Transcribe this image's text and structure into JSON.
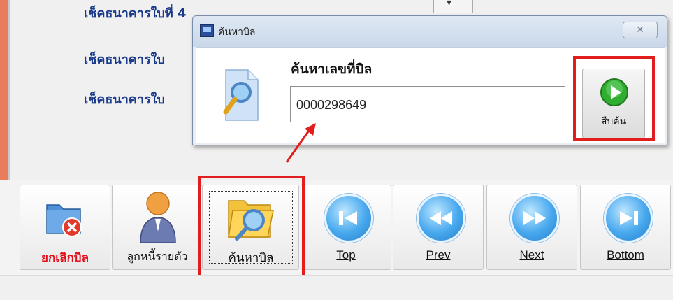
{
  "background": {
    "field_labels": [
      "เช็คธนาคารใบที่ 4",
      "เช็คธนาคารใบ",
      "เช็คธนาคารใบ"
    ]
  },
  "dialog": {
    "title": "ค้นหาบิล",
    "close_symbol": "✕",
    "search_label": "ค้นหาเลขที่บิล",
    "search_value": "0000298649",
    "go_button_label": "สืบค้น"
  },
  "toolbar": {
    "buttons": [
      {
        "label": "ยกเลิกบิล",
        "icon": "cancel-folder-icon"
      },
      {
        "label": "ลูกหนี้รายตัว",
        "icon": "debtor-person-icon"
      },
      {
        "label": "ค้นหาบิล",
        "icon": "search-folder-icon"
      },
      {
        "label": "Top",
        "icon": "skip-first-icon"
      },
      {
        "label": "Prev",
        "icon": "rewind-icon"
      },
      {
        "label": "Next",
        "icon": "fast-forward-icon"
      },
      {
        "label": "Bottom",
        "icon": "skip-last-icon"
      }
    ]
  },
  "colors": {
    "highlight_red": "#e21d1d",
    "label_blue": "#1a3a8c",
    "cancel_red": "#e3101b"
  }
}
